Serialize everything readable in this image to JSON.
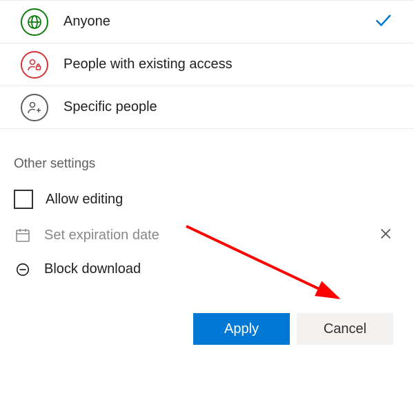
{
  "options": {
    "anyone": {
      "label": "Anyone",
      "selected": true
    },
    "existing": {
      "label": "People with existing access",
      "selected": false
    },
    "specific": {
      "label": "Specific people",
      "selected": false
    }
  },
  "otherSettings": {
    "heading": "Other settings",
    "allowEditing": {
      "label": "Allow editing",
      "checked": false
    },
    "expiration": {
      "label": "Set expiration date"
    },
    "blockDownload": {
      "label": "Block download",
      "enabled": true
    }
  },
  "buttons": {
    "apply": "Apply",
    "cancel": "Cancel"
  },
  "colors": {
    "accent": "#0078D4",
    "green": "#107C10",
    "red": "#D13438",
    "arrow": "#FF0000"
  }
}
